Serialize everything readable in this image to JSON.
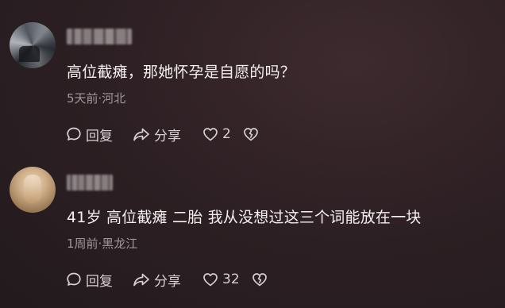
{
  "comments": [
    {
      "text": "高位截瘫，那她怀孕是自愿的吗？",
      "meta": "5天前·河北",
      "reply_label": "回复",
      "share_label": "分享",
      "like_count": "2"
    },
    {
      "text": "41岁 高位截瘫 二胎 我从没想过这三个词能放在一块",
      "meta": "1周前·黑龙江",
      "reply_label": "回复",
      "share_label": "分享",
      "like_count": "32"
    }
  ],
  "icons": {
    "reply": "reply-bubble-icon",
    "share": "share-arrow-icon",
    "like": "heart-icon",
    "dislike": "broken-heart-icon"
  },
  "colors": {
    "background": "#2e2024",
    "text": "#f4f0f0",
    "meta": "#a09799",
    "action": "#d8d1d3"
  }
}
